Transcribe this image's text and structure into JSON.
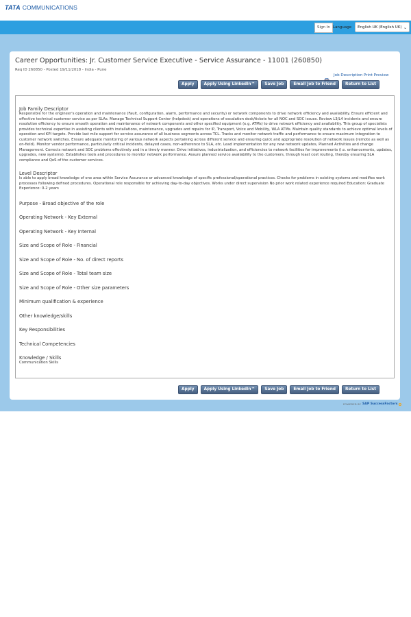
{
  "header": {
    "logo_primary": "TATA",
    "logo_secondary": "COMMUNICATIONS",
    "sign_in_label": "Sign In",
    "language_label": "Language",
    "language_selected": "English UK (English UK)"
  },
  "job": {
    "title": "Career Opportunities: Jr. Customer Service Executive - Service Assurance - 11001 (260850)",
    "req_line": "Req ID 260850 - Posted 19/11/2018 - India - Pune",
    "print_preview_label": "Job Description Print Preview"
  },
  "actions": {
    "apply": "Apply",
    "apply_linkedin": "Apply Using LinkedIn™",
    "save_job": "Save Job",
    "email_friend": "Email Job to Friend",
    "return_list": "Return to List"
  },
  "description": {
    "sections": [
      {
        "heading": "Job Family Descriptor",
        "body": "Responsible for the engineer's operation and maintenance (Fault, configuration, alarm, performance and security) or network components to drive network efficiency and availability. Ensure efficient and effective technical customer service as per SLAs. Manage Technical Support Center (helpdesk) and operations of escalation desk/tickets for all NOC and SOC issues. Review L3/L4 incidents and ensure resolution efficiency to ensure smooth operation and maintenance of network components and other specified equipment (e.g. ATMs) to drive network efficiency and availability. This group of specialists provides technical expertise in assisting clients with installations, maintenance, upgrades and repairs for IP, Transport, Voice and Mobility, WLA ATMs. Maintain quality standards to achieve optimal levels of operation and KPI targets. Provide last mile support for service assurance of all business segments across TCL. Tracks and monitor network traffic and performance to ensure maximum integration to customer network switches. Ensure adequate monitoring of various network aspects pertaining across different service and ensuring quick and appropriate resolution of network issues (remote as well as on-field). Monitor vendor performance, particularly critical incidents, delayed cases, non-adherence to SLA, etc. Lead implementation for any new network updates, Planned Activities and change Management. Corrects network and SOC problems effectively and in a timely manner. Drive initiatives, industrialization, and efficiencies to network facilities for improvements (i.e. enhancements, updates, upgrades, new systems). Establishes tools and procedures to monitor network performance. Assure planned service availability to the customers, through least cost routing, thereby ensuring SLA compliance and QoS of the customer services."
      },
      {
        "heading": "Level Descriptor",
        "body": "Is able to apply broad knowledge of one area within Service Assurance or advanced knowledge of specific professional/operational practices. Checks for problems in existing systems and modifies work processes following defined procedures. Operational role responsible for achieving day-to-day objectives. Works under direct supervision No prior work related experience required Education: Graduate Experience: 0-2 years"
      },
      {
        "heading": "Purpose - Broad objective of the role",
        "body": ""
      },
      {
        "heading": "Operating Network - Key External",
        "body": ""
      },
      {
        "heading": "Operating Network - Key Internal",
        "body": ""
      },
      {
        "heading": "Size and Scope of Role - Financial",
        "body": ""
      },
      {
        "heading": "Size and Scope of Role - No. of direct reports",
        "body": ""
      },
      {
        "heading": "Size and Scope of Role - Total team size",
        "body": ""
      },
      {
        "heading": "Size and Scope of Role - Other size parameters",
        "body": ""
      },
      {
        "heading": "Minimum qualification & experience",
        "body": ""
      },
      {
        "heading": "Other knowledge/skills",
        "body": ""
      },
      {
        "heading": "Key Responsibilities",
        "body": ""
      },
      {
        "heading": "Technical Competencies",
        "body": ""
      },
      {
        "heading": "Knowledge / Skills",
        "body": "Communication Skills"
      }
    ]
  },
  "footer": {
    "powered_by": "POWERED BY",
    "brand": "SAP SuccessFactors"
  },
  "colors": {
    "nav_blue": "#2d9fe0",
    "page_bg_blue": "#9cc9ea",
    "button_dark": "#465f80",
    "link_blue": "#1b5aa6"
  }
}
